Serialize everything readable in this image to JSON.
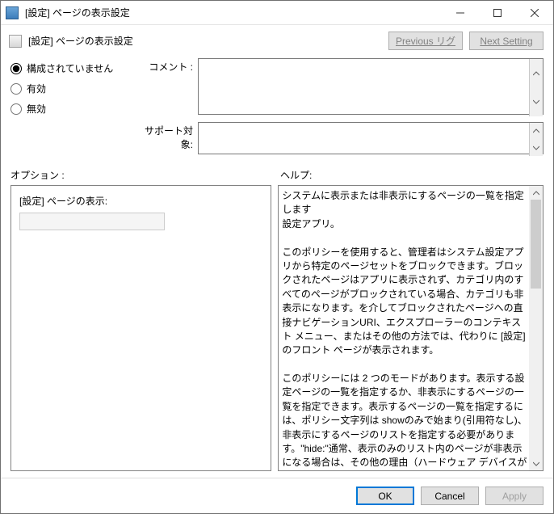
{
  "window": {
    "title": "[設定] ページの表示設定"
  },
  "header": {
    "title": "[設定] ページの表示設定",
    "prev": "Previous リグ",
    "next": "Next Setting"
  },
  "radios": {
    "not_configured": "構成されていません",
    "enabled": "有効",
    "disabled": "無効"
  },
  "fields": {
    "comment_label": "コメント :",
    "comment_value": "",
    "support_label": "サポート対象:",
    "support_value": ""
  },
  "sections": {
    "options": "オプション :",
    "help": "ヘルプ:"
  },
  "options": {
    "label": "[設定] ページの表示:",
    "value": ""
  },
  "help": {
    "text": "システムに表示または非表示にするページの一覧を指定します\n設定アプリ。\n\nこのポリシーを使用すると、管理者はシステム設定アプリから特定のページセットをブロックできます。ブロックされたページはアプリに表示されず、カテゴリ内のすべてのページがブロックされている場合、カテゴリも非表示になります。を介してブロックされたページへの直接ナビゲーションURI、エクスプローラーのコンテキスト メニュー、またはその他の方法では、代わりに [設定] のフロント ページが表示されます。\n\nこのポリシーには 2 つのモードがあります。表示する設定ページの一覧を指定するか、非表示にするページの一覧を指定できます。表示するページの一覧を指定するには、ポリシー文字列は showのみで始まり(引用符なし)、非表示にするページのリストを指定する必要があります。\"hide:\"通常、表示のみのリスト内のページが非表示になる場合は、その他の理由（ハードウェア デバイスが見つからないなど）、このポリシーは、そのページを強制的に表示しません。この後、ポリシー文字列設定ページのセミコロン区切りの一覧を含む必要があります識別子。特定の設定ページの識別子は、\nそのページの発行済み URI から mms プロトコルを差し引いた値一部。"
  },
  "footer": {
    "ok": "OK",
    "cancel": "Cancel",
    "apply": "Apply"
  }
}
